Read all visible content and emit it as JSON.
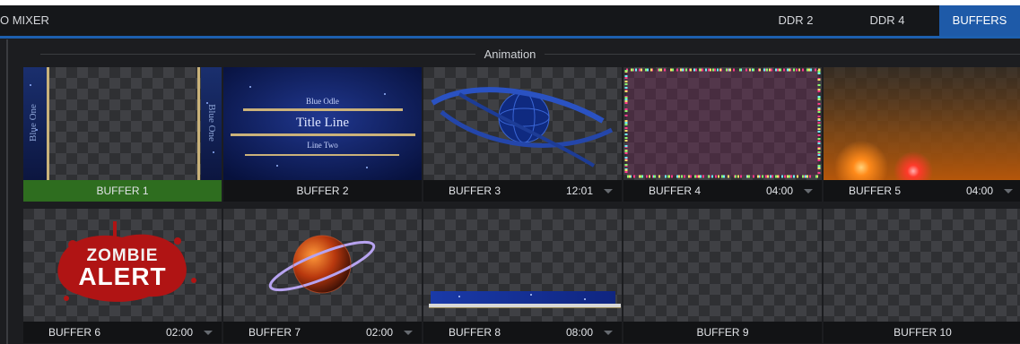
{
  "app_title": "O MIXER",
  "tabs": [
    {
      "label": "DDR 2",
      "active": false
    },
    {
      "label": "DDR 4",
      "active": false
    },
    {
      "label": "BUFFERS",
      "active": true
    }
  ],
  "section_title": "Animation",
  "buffers": [
    {
      "name": "BUFFER 1",
      "time": "",
      "selected": true,
      "thumb_text": [
        "Blue One",
        "Blue One"
      ]
    },
    {
      "name": "BUFFER 2",
      "time": "",
      "selected": false,
      "thumb_text": [
        "Blue Odle",
        "Title Line",
        "Line Two"
      ]
    },
    {
      "name": "BUFFER 3",
      "time": "12:01",
      "selected": false
    },
    {
      "name": "BUFFER 4",
      "time": "04:00",
      "selected": false
    },
    {
      "name": "BUFFER 5",
      "time": "04:00",
      "selected": false
    },
    {
      "name": "BUFFER 6",
      "time": "02:00",
      "selected": false,
      "thumb_text": [
        "ZOMBIE",
        "ALERT"
      ]
    },
    {
      "name": "BUFFER 7",
      "time": "02:00",
      "selected": false
    },
    {
      "name": "BUFFER 8",
      "time": "08:00",
      "selected": false
    },
    {
      "name": "BUFFER 9",
      "time": "",
      "selected": false
    },
    {
      "name": "BUFFER 10",
      "time": "",
      "selected": false
    }
  ],
  "colors": {
    "accent": "#1e5aa8",
    "selected": "#2e6d1f",
    "background": "#1c1d20"
  }
}
